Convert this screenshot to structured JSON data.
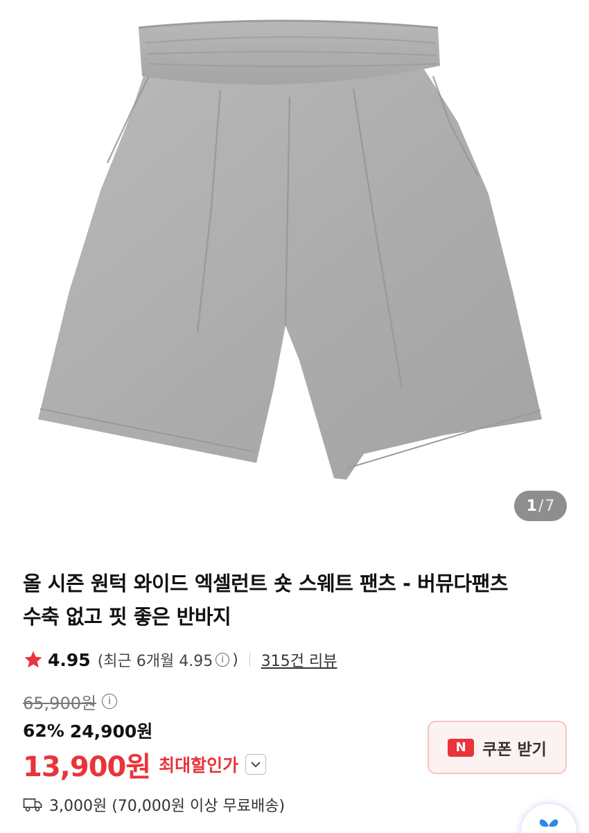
{
  "gallery": {
    "current": "1",
    "separator": "/",
    "total": "7",
    "product_image": "grey-sweat-shorts"
  },
  "product": {
    "title_line1": "올 시즌 원턱 와이드 엑셀런트 숏 스웨트 팬츠 - 버뮤다팬츠",
    "title_line2": "수축 없고 핏 좋은 반바지"
  },
  "rating": {
    "score": "4.95",
    "recent_label": "(최근 6개월 4.95",
    "recent_close": ")",
    "info_icon": "i",
    "reviews_link": "315건 리뷰"
  },
  "price": {
    "original": "65,900원",
    "discount_percent": "62%",
    "sale": "24,900원",
    "best": "13,900원",
    "best_label": "최대할인가"
  },
  "coupon": {
    "badge": "N",
    "label": "쿠폰 받기"
  },
  "shipping": {
    "text": "3,000원 (70,000원 이상 무료배송)"
  },
  "colors": {
    "accent_red": "#e8343a",
    "coupon_bg": "#fdf2f2",
    "counter_bg": "#6e6e6e"
  }
}
